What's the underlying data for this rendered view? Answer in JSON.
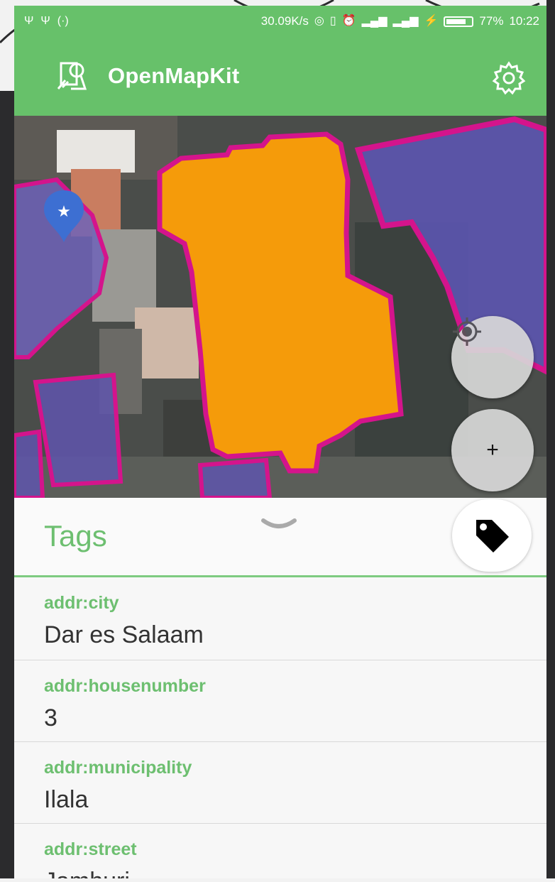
{
  "status_bar": {
    "left_icons": [
      "usb-icon",
      "usb-debug-icon",
      "hotspot-icon"
    ],
    "left_glyphs": [
      "Ψ",
      "Ψ",
      "(·)"
    ],
    "net_speed": "30.09K/s",
    "battery_percent": "77%",
    "battery_level": 0.77,
    "time": "10:22"
  },
  "app_bar": {
    "title": "OpenMapKit",
    "background": "#67c16a"
  },
  "map": {
    "locate_icon": "crosshair-icon",
    "zoom_in_label": "+"
  },
  "tags_panel": {
    "title": "Tags",
    "accent": "#6dbf70",
    "items": [
      {
        "key": "addr:city",
        "value": "Dar es Salaam"
      },
      {
        "key": "addr:housenumber",
        "value": "3"
      },
      {
        "key": "addr:municipality",
        "value": "Ilala"
      },
      {
        "key": "addr:street",
        "value": "Jamhuri"
      }
    ]
  }
}
